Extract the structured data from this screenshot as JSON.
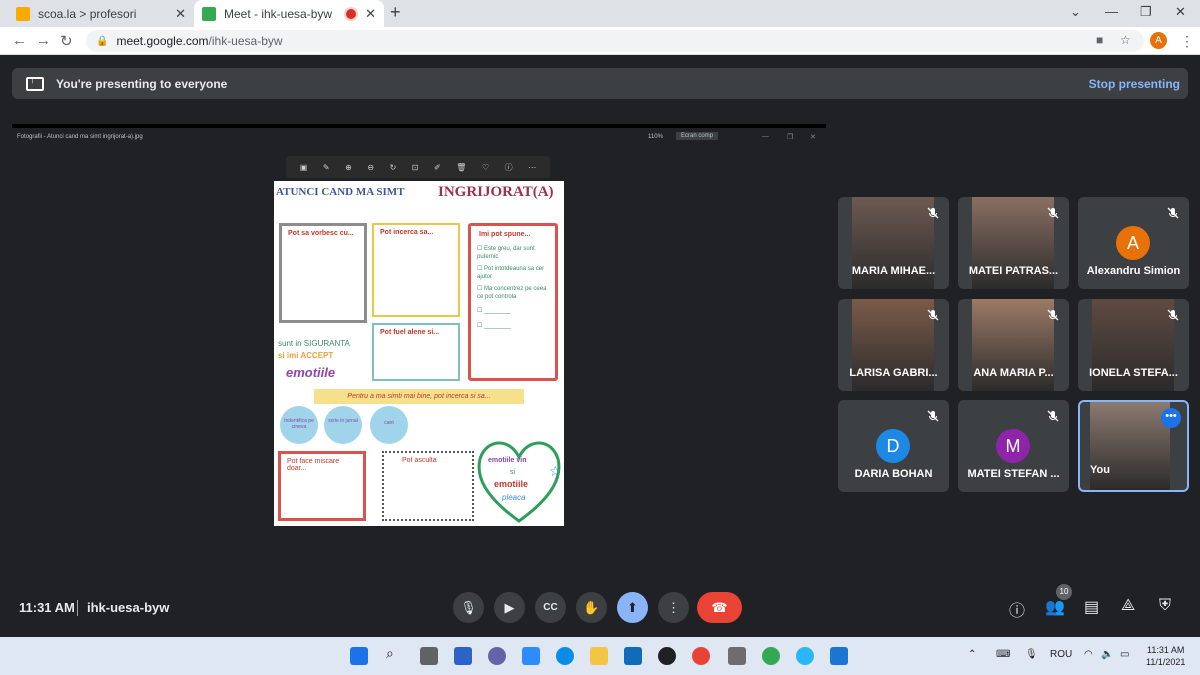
{
  "browser": {
    "tabs": [
      {
        "label": "scoa.la > profesori",
        "active": false
      },
      {
        "label": "Meet - ihk-uesa-byw",
        "active": true
      }
    ],
    "url_host": "meet.google.com",
    "url_path": "/ihk-uesa-byw",
    "profile_initial": "A"
  },
  "banner": {
    "text": "You're presenting to everyone",
    "stop_label": "Stop presenting"
  },
  "shared_window": {
    "title": "Fotografii - Atunci cand ma simt ingrijorat-a).jpg",
    "zoom": "110%",
    "fullscreen_label": "Ecran comp"
  },
  "poster": {
    "heading_left": "ATUNCI CAND MA SIMT",
    "heading_right": "INGRIJORAT(A)",
    "box1": "Pot sa vorbesc cu...",
    "box2": "Pot incerca sa...",
    "box3": "Imi pot spune...",
    "checklist": [
      "Este greu, dar sunt puternic",
      "Pot intotdeauna sa cer ajutor",
      "Ma concentrez pe ceea ce pot controla"
    ],
    "box4": "Pot fuel alene si...",
    "safety_line1": "sunt in SIGURANTA",
    "safety_line2": "si imi ACCEPT",
    "safety_line3": "emotiile",
    "banner_text": "Pentru a ma simti mai bine, pot incerca si sa...",
    "circles": [
      "Indentifica pe cineva",
      "scrie in jurnal",
      "cant"
    ],
    "box5": "Pot face miscare doar...",
    "box6": "Pot asculta",
    "heart_line1": "emotiile vin",
    "heart_line2": "si",
    "heart_line3": "emotiile",
    "heart_line4": "pleaca"
  },
  "participants": [
    {
      "name": "MARIA MIHAE...",
      "type": "video",
      "color": "#6d5a52"
    },
    {
      "name": "MATEI PATRAS...",
      "type": "video",
      "color": "#8a6f62"
    },
    {
      "name": "Alexandru Simion",
      "type": "avatar",
      "initial": "A",
      "color": "#e8710a"
    },
    {
      "name": "LARISA GABRI...",
      "type": "video",
      "color": "#7b5b4a"
    },
    {
      "name": "ANA MARIA P...",
      "type": "video",
      "color": "#9c7a66"
    },
    {
      "name": "IONELA STEFA...",
      "type": "video",
      "color": "#5f4a40"
    },
    {
      "name": "DARIA BOHAN",
      "type": "avatar",
      "initial": "D",
      "color": "#1e88e5"
    },
    {
      "name": "MATEI STEFAN ...",
      "type": "avatar",
      "initial": "M",
      "color": "#8e24aa"
    },
    {
      "name": "You",
      "type": "video",
      "color": "#8c7a70",
      "is_self": true
    }
  ],
  "controls": {
    "time": "11:31 AM",
    "meeting_code": "ihk-uesa-byw",
    "participant_count": "10"
  },
  "taskbar": {
    "language": "ROU",
    "clock_time": "11:31 AM",
    "clock_date": "11/1/2021"
  }
}
